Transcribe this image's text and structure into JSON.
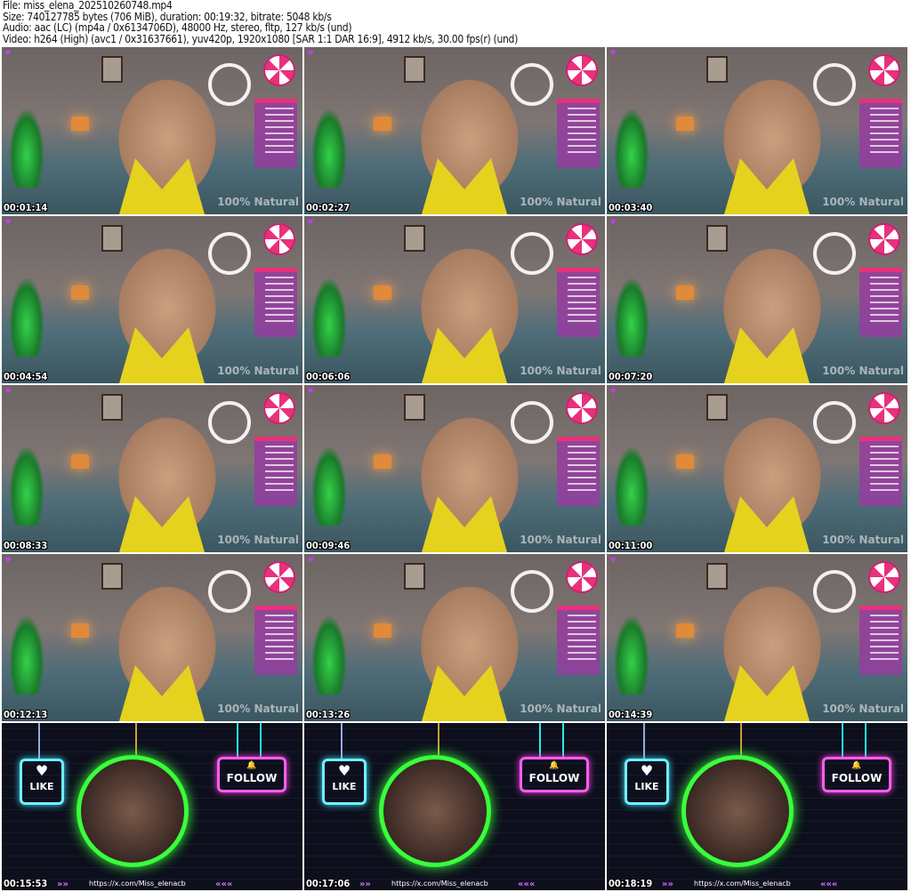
{
  "header": {
    "file": "File: miss_elena_202510260748.mp4",
    "size": "Size: 740127785 bytes (706 MiB), duration: 00:19:32, bitrate: 5048 kb/s",
    "audio": "Audio: aac (LC) (mp4a / 0x6134706D), 48000 Hz, stereo, fltp, 127 kb/s (und)",
    "video": "Video: h264 (High) (avc1 / 0x31637661), yuv420p, 1920x1080 [SAR 1:1 DAR 16:9], 4912 kb/s, 30.00 fps(r) (und)"
  },
  "outro": {
    "like": "LIKE",
    "follow": "FOLLOW",
    "url": "https://x.com/Miss_elenacb",
    "arrows_right": "»»",
    "arrows_left": "«««"
  },
  "watermark": "100% Natural",
  "thumbnails": [
    {
      "time": "00:01:14",
      "scene": "stream"
    },
    {
      "time": "00:02:27",
      "scene": "stream"
    },
    {
      "time": "00:03:40",
      "scene": "stream"
    },
    {
      "time": "00:04:54",
      "scene": "stream"
    },
    {
      "time": "00:06:06",
      "scene": "stream"
    },
    {
      "time": "00:07:20",
      "scene": "stream"
    },
    {
      "time": "00:08:33",
      "scene": "stream"
    },
    {
      "time": "00:09:46",
      "scene": "stream"
    },
    {
      "time": "00:11:00",
      "scene": "stream"
    },
    {
      "time": "00:12:13",
      "scene": "stream"
    },
    {
      "time": "00:13:26",
      "scene": "stream"
    },
    {
      "time": "00:14:39",
      "scene": "stream"
    },
    {
      "time": "00:15:53",
      "scene": "outro"
    },
    {
      "time": "00:17:06",
      "scene": "outro"
    },
    {
      "time": "00:18:19",
      "scene": "outro"
    }
  ]
}
